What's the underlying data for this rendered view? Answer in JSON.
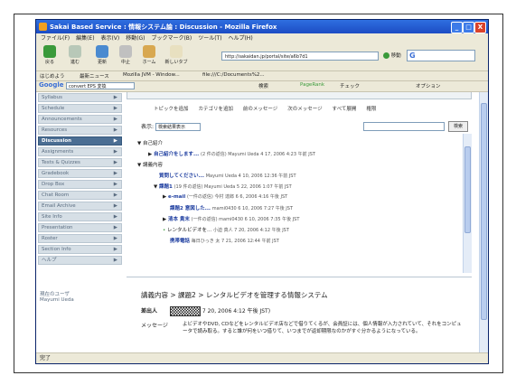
{
  "window": {
    "title": "Sakai Based Service : 情報システム論 : Discussion - Mozilla Firefox",
    "buttons": [
      "_",
      "□",
      "X"
    ]
  },
  "menu": [
    "ファイル(F)",
    "編集(E)",
    "表示(V)",
    "移動(G)",
    "ブックマーク(B)",
    "ツール(T)",
    "ヘルプ(H)"
  ],
  "toolbar": {
    "back": "戻る",
    "forward": "進む",
    "reload": "更新",
    "stop": "中止",
    "home": "ホーム",
    "newtab": "新しいタブ",
    "url": "http://sakaidan.jp/portal/site/a6b7d1",
    "go": "移動"
  },
  "bookmarks": [
    "はじめよう",
    "最新ニュース",
    "Mozilla JVM - Window...",
    "file:///C:/Documents%2..."
  ],
  "google_bar": {
    "logo": "Google",
    "query": "convert EPS 変換",
    "search_label": "検索",
    "pagerank": "PageRank",
    "spell": "チェック",
    "options": "オプション"
  },
  "sidebar": {
    "items": [
      {
        "label": "Syllabus",
        "active": false
      },
      {
        "label": "Schedule",
        "active": false
      },
      {
        "label": "Announcements",
        "active": false
      },
      {
        "label": "Resources",
        "active": false
      },
      {
        "label": "Discussion",
        "active": true
      },
      {
        "label": "Assignments",
        "active": false
      },
      {
        "label": "Tests & Quizzes",
        "active": false
      },
      {
        "label": "Gradebook",
        "active": false
      },
      {
        "label": "Drop Box",
        "active": false
      },
      {
        "label": "Chat Room",
        "active": false
      },
      {
        "label": "Email Archive",
        "active": false
      },
      {
        "label": "Site Info",
        "active": false
      },
      {
        "label": "Presentation",
        "active": false
      },
      {
        "label": "Roster",
        "active": false
      },
      {
        "label": "Section Info",
        "active": false
      },
      {
        "label": "ヘルプ",
        "active": false
      }
    ],
    "online_label": "現在のユーザ",
    "online_user": "Mayumi Ueda"
  },
  "main": {
    "tabs": [
      "トピックを追加",
      "カテゴリを追加",
      "前のメッセージ",
      "次のメッセージ",
      "すべて展開",
      "権限"
    ],
    "view_label": "表示:",
    "view_value": "検索結果表示",
    "search_button": "検索"
  },
  "tree": [
    {
      "text": "自己紹介",
      "meta": ""
    },
    {
      "text": "自己紹介をします...",
      "meta": "(2 件の返信) Mayumi Ueda 4 17, 2006 4:23 午前 JST"
    },
    {
      "text": "講義内容",
      "meta": ""
    },
    {
      "text": "質問してください...",
      "meta": "Mayumi Ueda 4 10, 2006 12:36 午前 JST"
    },
    {
      "text": "課題1",
      "meta": "(19 件の返信) Mayumi Ueda 5 22, 2006 1:07 午前 JST"
    },
    {
      "text": "e-mail",
      "meta": "(一件の返信) 今村 達郎 6 6, 2006 4:16 午後 JST"
    },
    {
      "text": "課題2 意図した...",
      "meta": "mami0430 6 10, 2006 7:27 午後 JST"
    },
    {
      "text": "清本 貴末",
      "meta": "(一件の返信) mami0430 6 10, 2006 7:35 午後 JST"
    },
    {
      "text": "レンタルビデオを...",
      "meta": "小迫 真人 7 20, 2006 4:12 午後 JST"
    },
    {
      "text": "携帯電話",
      "meta": "毎日ひっき 太 7 21, 2006 12:44 午前 JST"
    }
  ],
  "detail": {
    "breadcrumb": "講義内容 > 課題2 > レンタルビデオを管理する情報システム",
    "author_label": "差出人",
    "date": "7 20, 2006 4:12 午後 JST)",
    "message_label": "メッセージ",
    "message": "よビデオやDVD, CDなどをレンタルビデオ店などで借りてくるが、会員証には、個人情報が入力されていて、それをコンピュータで読み取る。すると誰が何をいつ借りて、いつまでが返却期限なのかがすぐ分かるようになっている。"
  },
  "status": "完了"
}
